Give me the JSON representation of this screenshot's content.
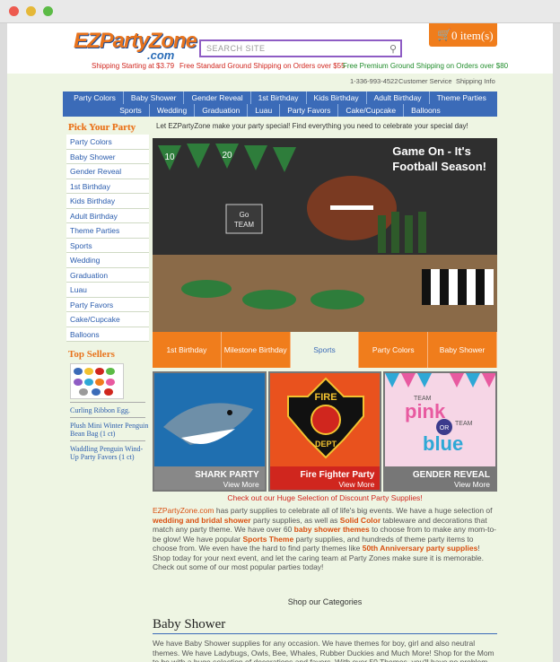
{
  "colors": {
    "orange": "#f07d1c",
    "nav_blue": "#3b6bb8",
    "link_blue": "#2a5cad",
    "red": "#d0261e",
    "green": "#1f8c2a",
    "page_bg": "#eef5e3"
  },
  "browser": {
    "close": "#ed5a4f",
    "minimize": "#e5b838",
    "maximize": "#5cbb46"
  },
  "logo": {
    "text": "EZPartyZone",
    "suffix": ".com"
  },
  "search": {
    "placeholder": "SEARCH SITE",
    "icon": "search-icon"
  },
  "cart": {
    "label": "0 item(s)",
    "icon": "cart-icon"
  },
  "shipping": {
    "starting": "Shipping Starting at $3.79",
    "standard": "Free Standard Ground Shipping on Orders over $55",
    "premium": "Free Premium Ground Shipping on Orders over $80"
  },
  "utility": {
    "phone": "1-336-993-4522",
    "service": "Customer Service",
    "info": "Shipping Info"
  },
  "nav": {
    "row1": [
      "Party Colors",
      "Baby Shower",
      "Gender Reveal",
      "1st Birthday",
      "Kids Birthday",
      "Adult Birthday",
      "Theme Parties"
    ],
    "row2": [
      "Sports",
      "Wedding",
      "Graduation",
      "Luau",
      "Party Favors",
      "Cake/Cupcake",
      "Balloons"
    ]
  },
  "sidebar": {
    "title": "Pick Your Party",
    "items": [
      "Party Colors",
      "Baby Shower",
      "Gender Reveal",
      "1st Birthday",
      "Kids Birthday",
      "Adult Birthday",
      "Theme Parties",
      "Sports",
      "Wedding",
      "Graduation",
      "Luau",
      "Party Favors",
      "Cake/Cupcake",
      "Balloons"
    ],
    "top_sellers_title": "Top Sellers",
    "top_sellers": [
      "Curling Ribbon Egg.",
      "Plush Mini Winter Penguin Bean Bag (1 ct)",
      "Waddling Penguin Wind-Up Party Favors (1 ct)"
    ]
  },
  "main": {
    "intro": "Let EZPartyZone make your party special! Find everything you need to celebrate your special day!",
    "hero": {
      "line1": "Game On - It's",
      "line2": "Football Season!",
      "flag1": "10",
      "flag2": "20",
      "sign1": "Go",
      "sign2": "TEAM"
    },
    "tabs": [
      "1st Birthday",
      "Milestone Birthday",
      "Sports",
      "Party Colors",
      "Baby Shower"
    ],
    "active_tab": "Sports",
    "cards": [
      {
        "title": "SHARK PARTY",
        "more": "View More"
      },
      {
        "title": "Fire Fighter Party",
        "more": "View More",
        "badge_top": "FIRE",
        "badge_bottom": "DEPT"
      },
      {
        "title": "GENDER REVEAL",
        "more": "View More",
        "pink": "pink",
        "or": "OR",
        "blue": "blue",
        "team1": "TEAM",
        "team2": "TEAM"
      }
    ],
    "discount": "Check out our Huge Selection of Discount Party Supplies!",
    "body": {
      "site": "EZPartyZone.com",
      "t1": " has party supplies to celebrate all of life's big events. We have a huge selection of ",
      "wedding": "wedding and bridal shower",
      "t2": " party supplies, as well as ",
      "solid": "Solid Color",
      "t3": " tableware and decorations that match any party theme. We have over 60 ",
      "baby": "baby shower themes",
      "t4": " to choose from to make any mom-to-be glow! We have popular ",
      "sports": "Sports Theme",
      "t5": " party supplies, and hundreds of theme party items to choose from. We even have the hard to find party themes like ",
      "anniv": "50th Anniversary party supplies",
      "t6": "! Shop today for your next event, and let the caring team at Party Zones make sure it is memorable. Check out some of our most popular parties today!"
    },
    "shop_categories": "Shop our Categories",
    "category_title": "Baby Shower",
    "category_text": "We have Baby Shower supplies for any occasion. We have themes for boy, girl and also neutral themes. We have Ladybugs, Owls, Bee, Whales, Rubber Duckies and Much More! Shop for the Mom to be with a huge selection of decorations and favors. With over 50 Themes, you'll have no problem planning the perfect baby shower."
  }
}
